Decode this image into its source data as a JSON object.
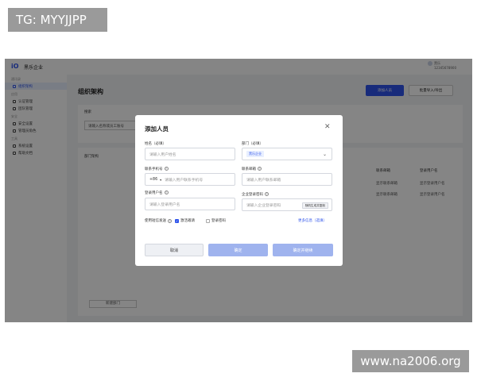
{
  "watermarks": {
    "top_left": "TG: MYYJJPP",
    "bottom_right": "www.na2006.org"
  },
  "app": {
    "logo": "iO",
    "company_name": "黑乐企业",
    "user": {
      "name": "黑乐",
      "subtitle": "12345678900"
    },
    "sidebar": {
      "groups": [
        {
          "title": "通讯录",
          "items": [
            {
              "label": "组织架构",
              "active": true
            }
          ]
        },
        {
          "title": "应用",
          "items": [
            {
              "label": "认证管理"
            },
            {
              "label": "团队管理"
            }
          ]
        },
        {
          "title": "安全",
          "items": [
            {
              "label": "安全设置"
            },
            {
              "label": "管理员角色"
            }
          ]
        },
        {
          "title": "工具",
          "items": [
            {
              "label": "系统设置"
            }
          ]
        },
        {
          "title": "",
          "items": [
            {
              "label": "帮助文档"
            }
          ]
        }
      ]
    },
    "main": {
      "title": "组织架构",
      "add_button": "添加人员",
      "import_button": "批量导入/导出",
      "search_label": "搜索",
      "search_placeholder": "请输入名称或员工账号",
      "dept_label": "部门架构",
      "table_headers": [
        "联系邮箱",
        "登录用户名"
      ],
      "table_rows": [
        [
          "显示联系邮箱",
          "显示登录用户名"
        ],
        [
          "显示联系邮箱",
          "显示登录用户名"
        ]
      ],
      "add_dept_button": "新建部门"
    }
  },
  "modal": {
    "title": "添加人员",
    "close_icon": "close-icon",
    "name": {
      "label": "姓名（必填）",
      "placeholder": "请输入用户姓名"
    },
    "department": {
      "label": "部门（必填）",
      "value": "黑乐企业"
    },
    "phone": {
      "label": "联系手机号",
      "prefix": "+86",
      "placeholder": "请输入用户联系手机号"
    },
    "email": {
      "label": "联系邮箱",
      "placeholder": "请输入用户联系邮箱"
    },
    "username": {
      "label": "登录用户名",
      "placeholder": "请输入登录用户名"
    },
    "password": {
      "label": "企业登录密码",
      "placeholder": "请输入企业登录密码",
      "generate_button": "随机生成并复制"
    },
    "sms": {
      "label": "使用短信发送",
      "option_activate": "激活邀请",
      "option_activate_checked": true,
      "option_password": "登录密码",
      "option_password_checked": false
    },
    "more_link": "更多信息（选填）",
    "buttons": {
      "cancel": "取消",
      "confirm": "确定",
      "confirm_next": "确定并继续"
    }
  }
}
